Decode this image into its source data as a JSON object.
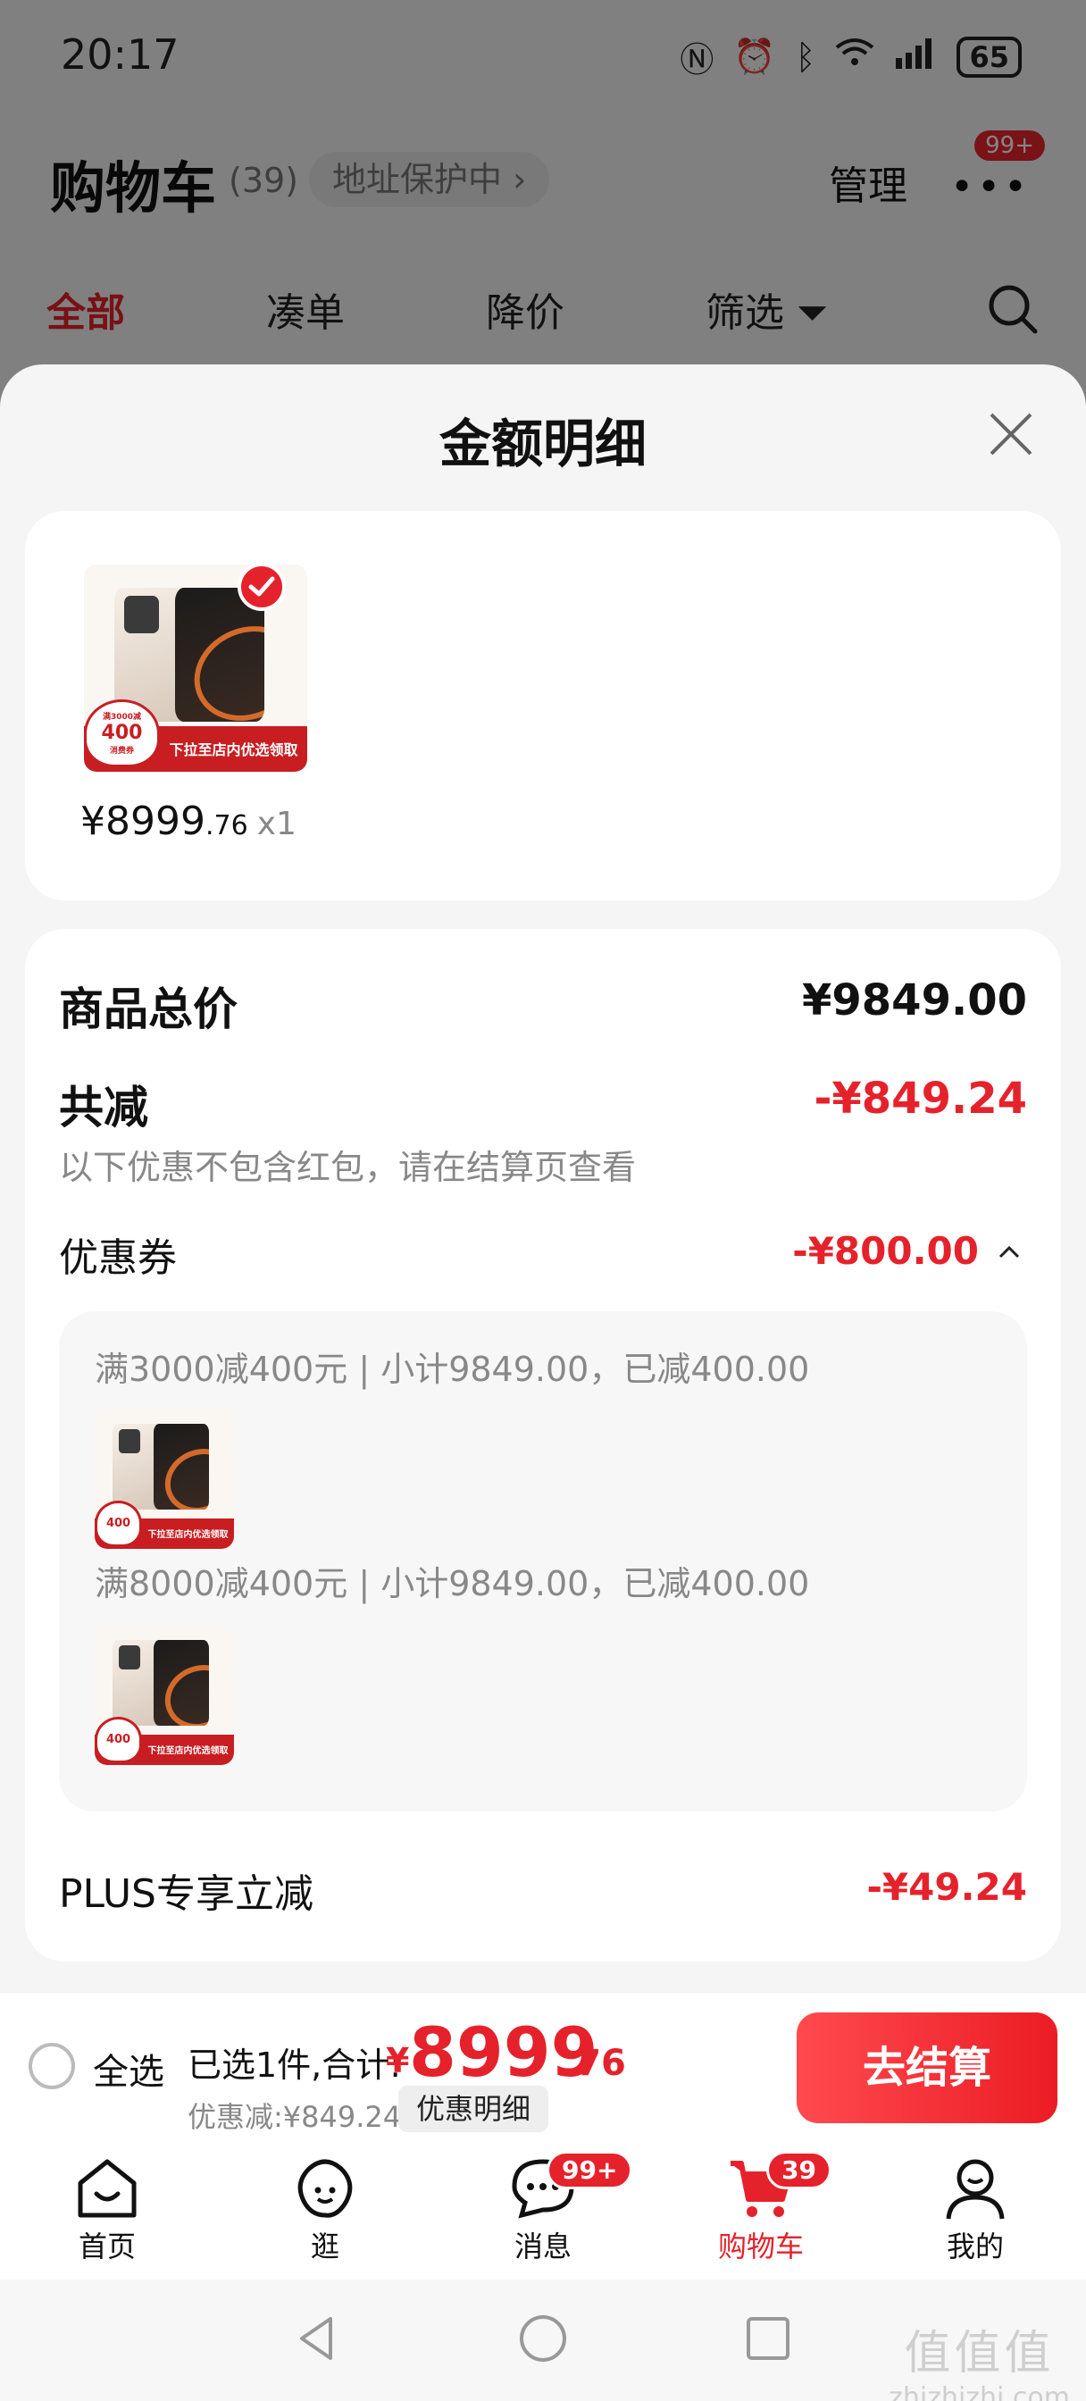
{
  "status_bar": {
    "time": "20:17",
    "battery": "65"
  },
  "header": {
    "title": "购物车",
    "count": "(39)",
    "address_protect": "地址保护中 ›",
    "manage": "管理",
    "more_badge": "99+"
  },
  "tabs": [
    "全部",
    "凑单",
    "降价",
    "筛选"
  ],
  "sheet": {
    "title": "金额明细",
    "product": {
      "price_int": "¥8999",
      "price_dec": ".76",
      "qty": "x1",
      "promo_badge_value": "400",
      "promo_badge_top": "满3000减",
      "promo_badge_bottom": "消费券",
      "promo_text": "下拉至店内优选领取"
    },
    "detail": {
      "total_label": "商品总价",
      "total_value": "¥9849.00",
      "reduce_label": "共减",
      "reduce_value": "-¥849.24",
      "reduce_note": "以下优惠不包含红包，请在结算页查看",
      "coupon_label": "优惠券",
      "coupon_value": "-¥800.00",
      "coupons": [
        {
          "text": "满3000减400元 | 小计9849.00，已减400.00"
        },
        {
          "text": "满8000减400元 | 小计9849.00，已减400.00"
        }
      ],
      "plus_label": "PLUS专享立减",
      "plus_value": "-¥49.24"
    }
  },
  "settle_bar": {
    "select_all": "全选",
    "selected": "已选1件,合计:",
    "yen": "¥",
    "total_int": "8999",
    "total_dec": ".76",
    "discount": "优惠减:¥849.24",
    "detail_button": "优惠明细",
    "checkout": "去结算"
  },
  "bottom_nav": [
    {
      "label": "首页",
      "icon": "home-icon"
    },
    {
      "label": "逛",
      "icon": "browse-icon"
    },
    {
      "label": "消息",
      "icon": "message-icon",
      "badge": "99+"
    },
    {
      "label": "购物车",
      "icon": "cart-icon",
      "badge": "39",
      "active": true
    },
    {
      "label": "我的",
      "icon": "profile-icon"
    }
  ],
  "watermark": {
    "main": "值值值",
    "sub": "zhizhizhi.com"
  },
  "colors": {
    "accent": "#e5222b",
    "overlay": "rgba(0,0,0,0.48)"
  }
}
